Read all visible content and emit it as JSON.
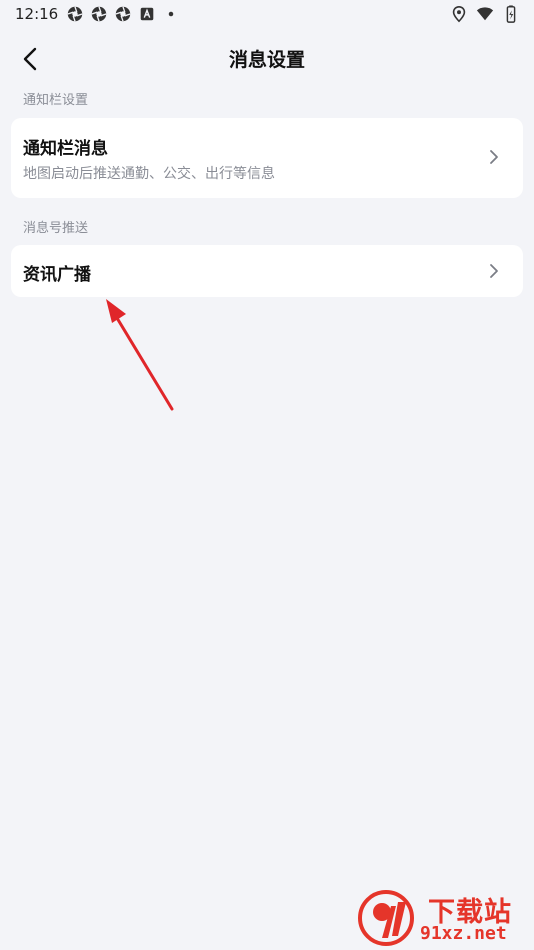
{
  "status_bar": {
    "time": "12:16",
    "left_icons": [
      "aperture-icon",
      "aperture-icon",
      "aperture-icon",
      "font-app-icon",
      "dot-icon"
    ],
    "right_icons": [
      "location-icon",
      "wifi-icon",
      "battery-charging-icon"
    ]
  },
  "header": {
    "title": "消息设置"
  },
  "sections": [
    {
      "label": "通知栏设置",
      "items": [
        {
          "title": "通知栏消息",
          "subtitle": "地图启动后推送通勤、公交、出行等信息"
        }
      ]
    },
    {
      "label": "消息号推送",
      "items": [
        {
          "title": "资讯广播"
        }
      ]
    }
  ],
  "annotation": {
    "color": "#e0262a"
  },
  "watermark": {
    "line1": "下载站",
    "line2": "91xz.net",
    "color": "#e5352a"
  },
  "colors": {
    "background": "#f3f4f8",
    "card": "#ffffff",
    "secondary_text": "#8a8d96"
  }
}
